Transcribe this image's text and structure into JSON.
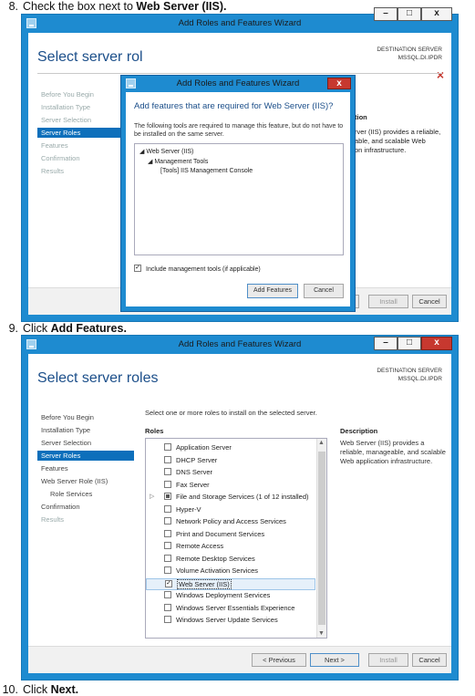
{
  "steps": [
    {
      "num": "8.",
      "prefix": "Check the box next to ",
      "bold": "Web Server (IIS)."
    },
    {
      "num": "9.",
      "prefix": "Click ",
      "bold": "Add Features."
    },
    {
      "num": "10.",
      "prefix": "Click ",
      "bold": "Next."
    }
  ],
  "wizard": {
    "title": "Add Roles and Features Wizard",
    "heading": "Select server roles",
    "heading_partial": "Select server rol",
    "destination_label": "DESTINATION SERVER",
    "destination_server": "MSSQL.DI.IPDR",
    "minimize_glyph": "–",
    "maximize_glyph": "□",
    "close_glyph": "x",
    "warn_glyph": "×"
  },
  "nav1": [
    "Before You Begin",
    "Installation Type",
    "Server Selection",
    "Server Roles",
    "Features",
    "Confirmation",
    "Results"
  ],
  "nav2": [
    "Before You Begin",
    "Installation Type",
    "Server Selection",
    "Server Roles",
    "Features",
    "Web Server Role (IIS)",
    "Role Services",
    "Confirmation",
    "Results"
  ],
  "buttons": {
    "previous": "< Previous",
    "next": "Next >",
    "install": "Install",
    "cancel": "Cancel"
  },
  "description1": {
    "frag_a": "tion",
    "frag_b": "rver (IIS) provides a reliable,",
    "frag_c": "able, and scalable Web",
    "frag_d": "on infrastructure."
  },
  "dialog": {
    "title": "Add Roles and Features Wizard",
    "heading": "Add features that are required for Web Server (IIS)?",
    "body": "The following tools are required to manage this feature, but do not have to be installed on the same server.",
    "tree": [
      "Web Server (IIS)",
      "Management Tools",
      "[Tools] IIS Management Console"
    ],
    "include_label": "Include management tools (if applicable)",
    "include_checked": true,
    "add_button": "Add Features",
    "cancel_button": "Cancel",
    "close_glyph": "x"
  },
  "roles_panel": {
    "instruction": "Select one or more roles to install on the selected server.",
    "roles_header": "Roles",
    "description_header": "Description",
    "description_text": "Web Server (IIS) provides a reliable, manageable, and scalable Web application infrastructure.",
    "roles": [
      {
        "label": "Application Server",
        "state": "off"
      },
      {
        "label": "DHCP Server",
        "state": "off"
      },
      {
        "label": "DNS Server",
        "state": "off"
      },
      {
        "label": "Fax Server",
        "state": "off"
      },
      {
        "label": "File and Storage Services (1 of 12 installed)",
        "state": "partial"
      },
      {
        "label": "Hyper-V",
        "state": "off"
      },
      {
        "label": "Network Policy and Access Services",
        "state": "off"
      },
      {
        "label": "Print and Document Services",
        "state": "off"
      },
      {
        "label": "Remote Access",
        "state": "off"
      },
      {
        "label": "Remote Desktop Services",
        "state": "off"
      },
      {
        "label": "Volume Activation Services",
        "state": "off"
      },
      {
        "label": "Web Server (IIS)",
        "state": "on"
      },
      {
        "label": "Windows Deployment Services",
        "state": "off"
      },
      {
        "label": "Windows Server Essentials Experience",
        "state": "off"
      },
      {
        "label": "Windows Server Update Services",
        "state": "off"
      }
    ]
  }
}
